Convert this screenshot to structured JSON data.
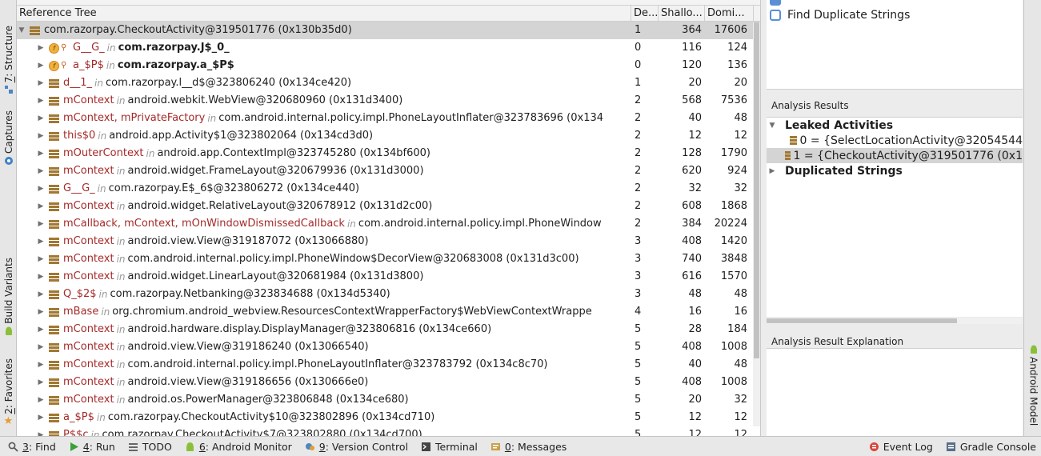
{
  "left_tabs": [
    {
      "prefix": "7",
      "label": ": Structure"
    },
    {
      "prefix": "",
      "label": "Captures"
    },
    {
      "prefix": "",
      "label": "Build Variants"
    },
    {
      "prefix": "2",
      "label": ": Favorites"
    }
  ],
  "right_tabs": [
    {
      "label": "Android Model"
    }
  ],
  "tree": {
    "columns": {
      "reference": "Reference Tree",
      "depth": "De...",
      "shallow": "Shallo...",
      "dominating": "Domi..."
    },
    "root": {
      "name": "com.razorpay.CheckoutActivity@319501776 (0x130b35d0)",
      "depth": "1",
      "shallow": "364",
      "dominating": "17606"
    },
    "rows": [
      {
        "kind": "static",
        "field": "G__G_",
        "in": "in",
        "cls": "com.razorpay.J$_0_",
        "bold": true,
        "depth": "0",
        "shallow": "116",
        "dominating": "124"
      },
      {
        "kind": "static",
        "field": "a_$P$",
        "in": "in",
        "cls": "com.razorpay.a_$P$",
        "bold": true,
        "depth": "0",
        "shallow": "120",
        "dominating": "136"
      },
      {
        "kind": "field",
        "field": "d__1_",
        "in": "in",
        "cls": "com.razorpay.l__d$@323806240 (0x134ce420)",
        "depth": "1",
        "shallow": "20",
        "dominating": "20"
      },
      {
        "kind": "field",
        "field": "mContext",
        "in": "in",
        "cls": "android.webkit.WebView@320680960 (0x131d3400)",
        "depth": "2",
        "shallow": "568",
        "dominating": "7536"
      },
      {
        "kind": "field",
        "field": "mContext, mPrivateFactory",
        "in": "in",
        "cls": "com.android.internal.policy.impl.PhoneLayoutInflater@323783696 (0x134",
        "depth": "2",
        "shallow": "40",
        "dominating": "48"
      },
      {
        "kind": "field",
        "field": "this$0",
        "in": "in",
        "cls": "android.app.Activity$1@323802064 (0x134cd3d0)",
        "depth": "2",
        "shallow": "12",
        "dominating": "12"
      },
      {
        "kind": "field",
        "field": "mOuterContext",
        "in": "in",
        "cls": "android.app.ContextImpl@323745280 (0x134bf600)",
        "depth": "2",
        "shallow": "128",
        "dominating": "1790"
      },
      {
        "kind": "field",
        "field": "mContext",
        "in": "in",
        "cls": "android.widget.FrameLayout@320679936 (0x131d3000)",
        "depth": "2",
        "shallow": "620",
        "dominating": "924"
      },
      {
        "kind": "field",
        "field": "G__G_",
        "in": "in",
        "cls": "com.razorpay.E$_6$@323806272 (0x134ce440)",
        "depth": "2",
        "shallow": "32",
        "dominating": "32"
      },
      {
        "kind": "field",
        "field": "mContext",
        "in": "in",
        "cls": "android.widget.RelativeLayout@320678912 (0x131d2c00)",
        "depth": "2",
        "shallow": "608",
        "dominating": "1868"
      },
      {
        "kind": "field",
        "field": "mCallback, mContext, mOnWindowDismissedCallback",
        "in": "in",
        "cls": "com.android.internal.policy.impl.PhoneWindow",
        "depth": "2",
        "shallow": "384",
        "dominating": "20224"
      },
      {
        "kind": "field",
        "field": "mContext",
        "in": "in",
        "cls": "android.view.View@319187072 (0x13066880)",
        "depth": "3",
        "shallow": "408",
        "dominating": "1420"
      },
      {
        "kind": "field",
        "field": "mContext",
        "in": "in",
        "cls": "com.android.internal.policy.impl.PhoneWindow$DecorView@320683008 (0x131d3c00)",
        "depth": "3",
        "shallow": "740",
        "dominating": "3848"
      },
      {
        "kind": "field",
        "field": "mContext",
        "in": "in",
        "cls": "android.widget.LinearLayout@320681984 (0x131d3800)",
        "depth": "3",
        "shallow": "616",
        "dominating": "1570"
      },
      {
        "kind": "field",
        "field": "Q_$2$",
        "in": "in",
        "cls": "com.razorpay.Netbanking@323834688 (0x134d5340)",
        "depth": "3",
        "shallow": "48",
        "dominating": "48"
      },
      {
        "kind": "field",
        "field": "mBase",
        "in": "in",
        "cls": "org.chromium.android_webview.ResourcesContextWrapperFactory$WebViewContextWrappe",
        "depth": "4",
        "shallow": "16",
        "dominating": "16"
      },
      {
        "kind": "field",
        "field": "mContext",
        "in": "in",
        "cls": "android.hardware.display.DisplayManager@323806816 (0x134ce660)",
        "depth": "5",
        "shallow": "28",
        "dominating": "184"
      },
      {
        "kind": "field",
        "field": "mContext",
        "in": "in",
        "cls": "android.view.View@319186240 (0x13066540)",
        "depth": "5",
        "shallow": "408",
        "dominating": "1008"
      },
      {
        "kind": "field",
        "field": "mContext",
        "in": "in",
        "cls": "com.android.internal.policy.impl.PhoneLayoutInflater@323783792 (0x134c8c70)",
        "depth": "5",
        "shallow": "40",
        "dominating": "48"
      },
      {
        "kind": "field",
        "field": "mContext",
        "in": "in",
        "cls": "android.view.View@319186656 (0x130666e0)",
        "depth": "5",
        "shallow": "408",
        "dominating": "1008"
      },
      {
        "kind": "field",
        "field": "mContext",
        "in": "in",
        "cls": "android.os.PowerManager@323806848 (0x134ce680)",
        "depth": "5",
        "shallow": "20",
        "dominating": "32"
      },
      {
        "kind": "field",
        "field": "a_$P$",
        "in": "in",
        "cls": "com.razorpay.CheckoutActivity$10@323802896 (0x134cd710)",
        "depth": "5",
        "shallow": "12",
        "dominating": "12"
      },
      {
        "kind": "field",
        "field": "P$$c",
        "in": "in",
        "cls": "com.razorpay.CheckoutActivity$7@323802880 (0x134cd700)",
        "depth": "5",
        "shallow": "12",
        "dominating": "12"
      }
    ]
  },
  "analysis": {
    "option_find_duplicate": "Find Duplicate Strings",
    "results_title": "Analysis Results",
    "leaked_label": "Leaked Activities",
    "leaked_items": [
      "0 = {SelectLocationActivity@32054544",
      "1 = {CheckoutActivity@319501776 (0x1"
    ],
    "duplicated_label": "Duplicated Strings",
    "explanation_title": "Analysis Result Explanation"
  },
  "bottom_tabs": [
    {
      "icon": "search-icon",
      "num": "3",
      "label": ": Find"
    },
    {
      "icon": "run-icon",
      "num": "4",
      "label": ": Run"
    },
    {
      "icon": "todo-icon",
      "num": "",
      "label": "TODO"
    },
    {
      "icon": "android-icon",
      "num": "6",
      "label": ": Android Monitor"
    },
    {
      "icon": "vcs-icon",
      "num": "9",
      "label": ": Version Control"
    },
    {
      "icon": "terminal-icon",
      "num": "",
      "label": "Terminal"
    },
    {
      "icon": "messages-icon",
      "num": "0",
      "label": ": Messages"
    }
  ],
  "bottom_right_tabs": [
    {
      "icon": "event-log-icon",
      "label": "Event Log"
    },
    {
      "icon": "gradle-icon",
      "label": "Gradle Console"
    }
  ],
  "colors": {
    "field_name": "#a52a2a",
    "field_icon": "#a07832",
    "selection": "#d4d4d4"
  }
}
